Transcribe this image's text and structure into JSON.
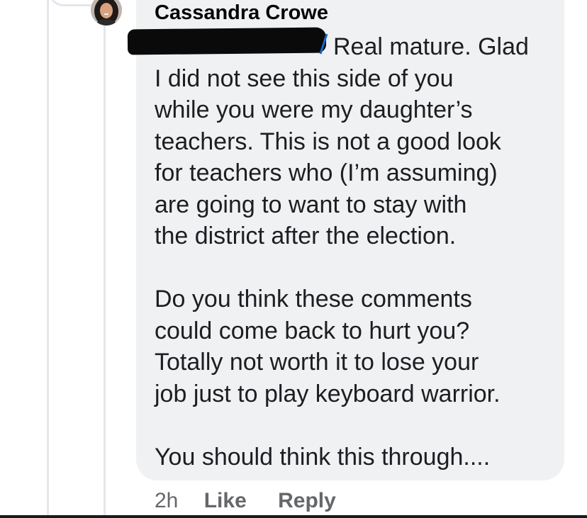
{
  "comment": {
    "author_name": "Cassandra Crowe",
    "avatar_icon": "profile-photo",
    "tagged_name_redacted": true,
    "lines": [
      "Real mature. Glad",
      "I did not see this side of you",
      "while you were my daughter’s",
      "teachers. This is not a good look",
      "for teachers who (I’m assuming)",
      "are going to want to stay with",
      "the district after the election.",
      "",
      "Do you think these comments",
      "could come back to hurt you?",
      "Totally not worth it to lose your",
      "job just to play keyboard warrior.",
      "",
      "You should think this through...."
    ]
  },
  "actions": {
    "timestamp": "2h",
    "like_label": "Like",
    "reply_label": "Reply"
  },
  "colors": {
    "bubble_bg": "#eff1f3",
    "text": "#1c1e21",
    "meta": "#65676b",
    "tag_link": "#1b66c9"
  }
}
